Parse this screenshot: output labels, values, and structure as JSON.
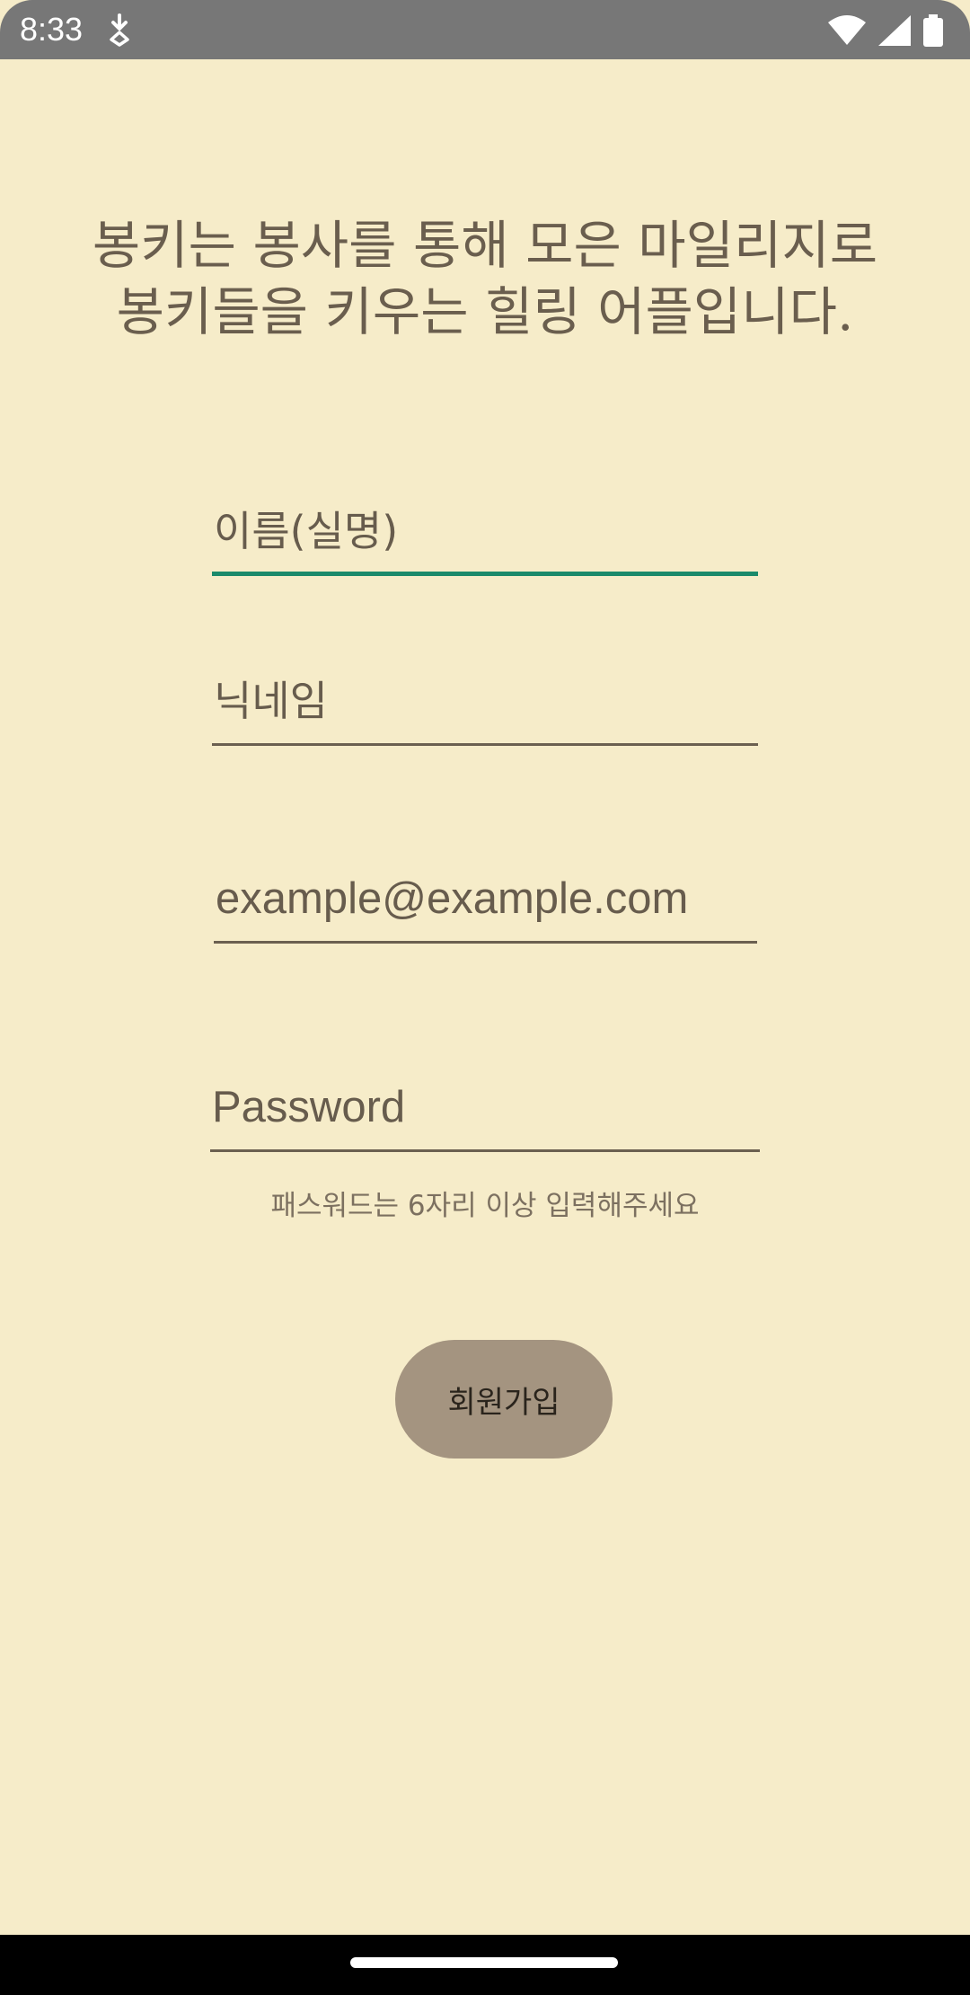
{
  "status_bar": {
    "time": "8:33",
    "notification_icon": "download-icon",
    "wifi_icon": "wifi-icon",
    "signal_icon": "cell-signal-icon",
    "battery_icon": "battery-icon"
  },
  "tagline": {
    "line1": "봉키는 봉사를 통해 모은 마일리지로",
    "line2": "봉키들을 키우는 힐링 어플입니다."
  },
  "form": {
    "name_placeholder": "이름(실명)",
    "nickname_placeholder": "닉네임",
    "email_placeholder": "example@example.com",
    "password_placeholder": "Password",
    "password_hint": "패스워드는 6자리 이상 입력해주세요"
  },
  "signup_button_label": "회원가입",
  "colors": {
    "background": "#f6ecc9",
    "accent_focused": "#1b8a6b",
    "button": "#a49480",
    "status_bar": "#777777"
  }
}
